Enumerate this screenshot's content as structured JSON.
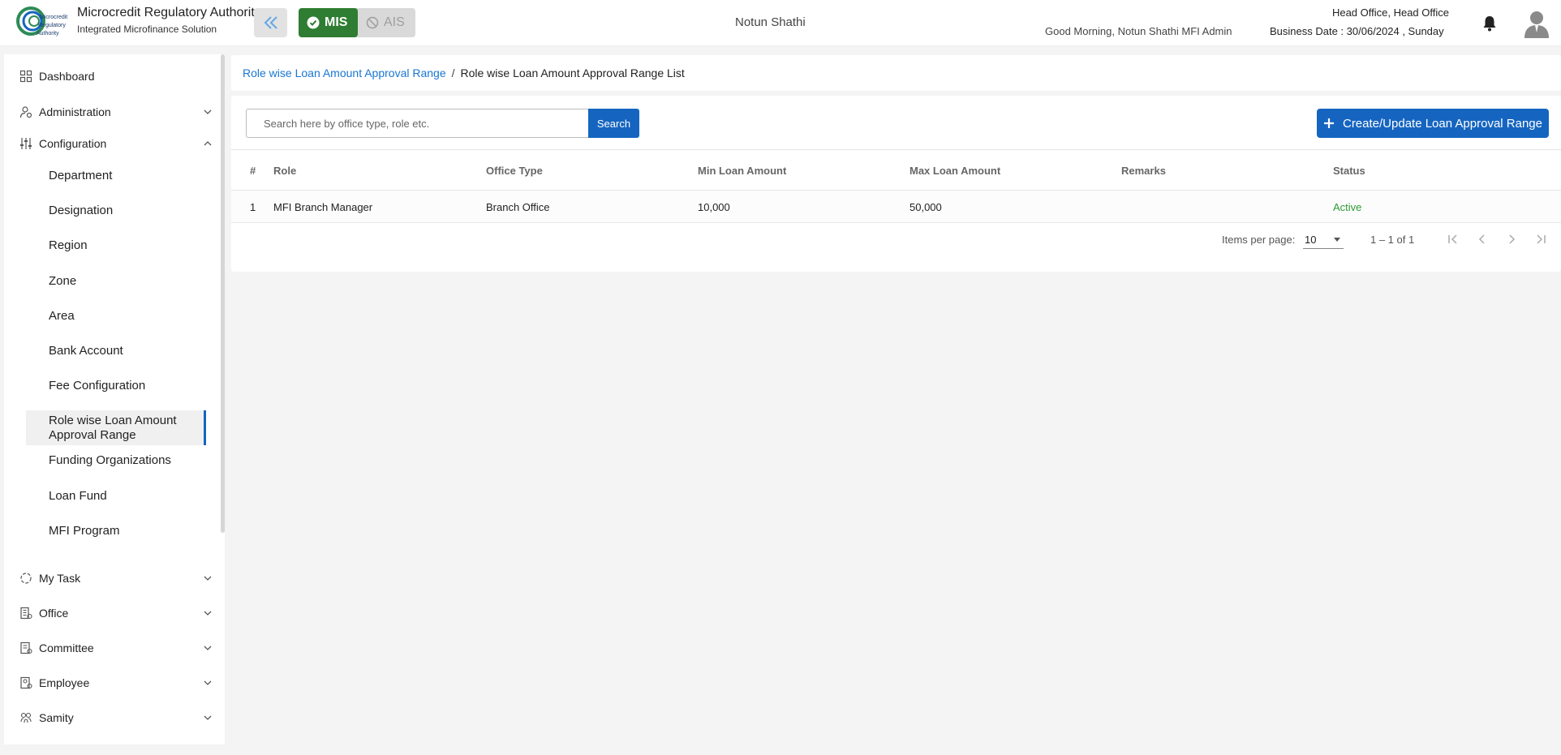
{
  "header": {
    "brand_title": "Microcredit Regulatory Authority",
    "brand_subtitle": "Integrated Microfinance Solution",
    "logo_text_1": "Microcredit",
    "logo_text_2": "Regulatory",
    "logo_text_3": "Authority",
    "mode_mis": "MIS",
    "mode_ais": "AIS",
    "org_name": "Notun Shathi",
    "greeting": "Good Morning, Notun Shathi MFI Admin",
    "office": "Head Office, Head Office",
    "business_date": "Business Date : 30/06/2024 , Sunday"
  },
  "sidebar": {
    "dashboard": "Dashboard",
    "administration": "Administration",
    "configuration": "Configuration",
    "config_items": [
      "Department",
      "Designation",
      "Region",
      "Zone",
      "Area",
      "Bank Account",
      "Fee Configuration",
      "Role wise Loan Amount Approval Range",
      "Funding Organizations",
      "Loan Fund",
      "MFI Program"
    ],
    "my_task": "My Task",
    "office": "Office",
    "committee": "Committee",
    "employee": "Employee",
    "samity": "Samity"
  },
  "breadcrumb": {
    "parent": "Role wise Loan Amount Approval Range",
    "separator": "/",
    "current": "Role wise Loan Amount Approval Range List"
  },
  "toolbar": {
    "search_placeholder": "Search here by office type, role etc.",
    "search_label": "Search",
    "create_label": "Create/Update Loan Approval Range"
  },
  "table": {
    "headers": [
      "#",
      "Role",
      "Office Type",
      "Min Loan Amount",
      "Max Loan Amount",
      "Remarks",
      "Status"
    ],
    "rows": [
      [
        "1",
        "MFI Branch Manager",
        "Branch Office",
        "10,000",
        "50,000",
        "",
        "Active"
      ]
    ]
  },
  "paginator": {
    "items_per_page_label": "Items per page:",
    "items_per_page": "10",
    "range": "1 – 1 of 1"
  },
  "colors": {
    "primary": "#1565c0",
    "mis_active": "#2e7d32",
    "status_active": "#2e9b32"
  }
}
